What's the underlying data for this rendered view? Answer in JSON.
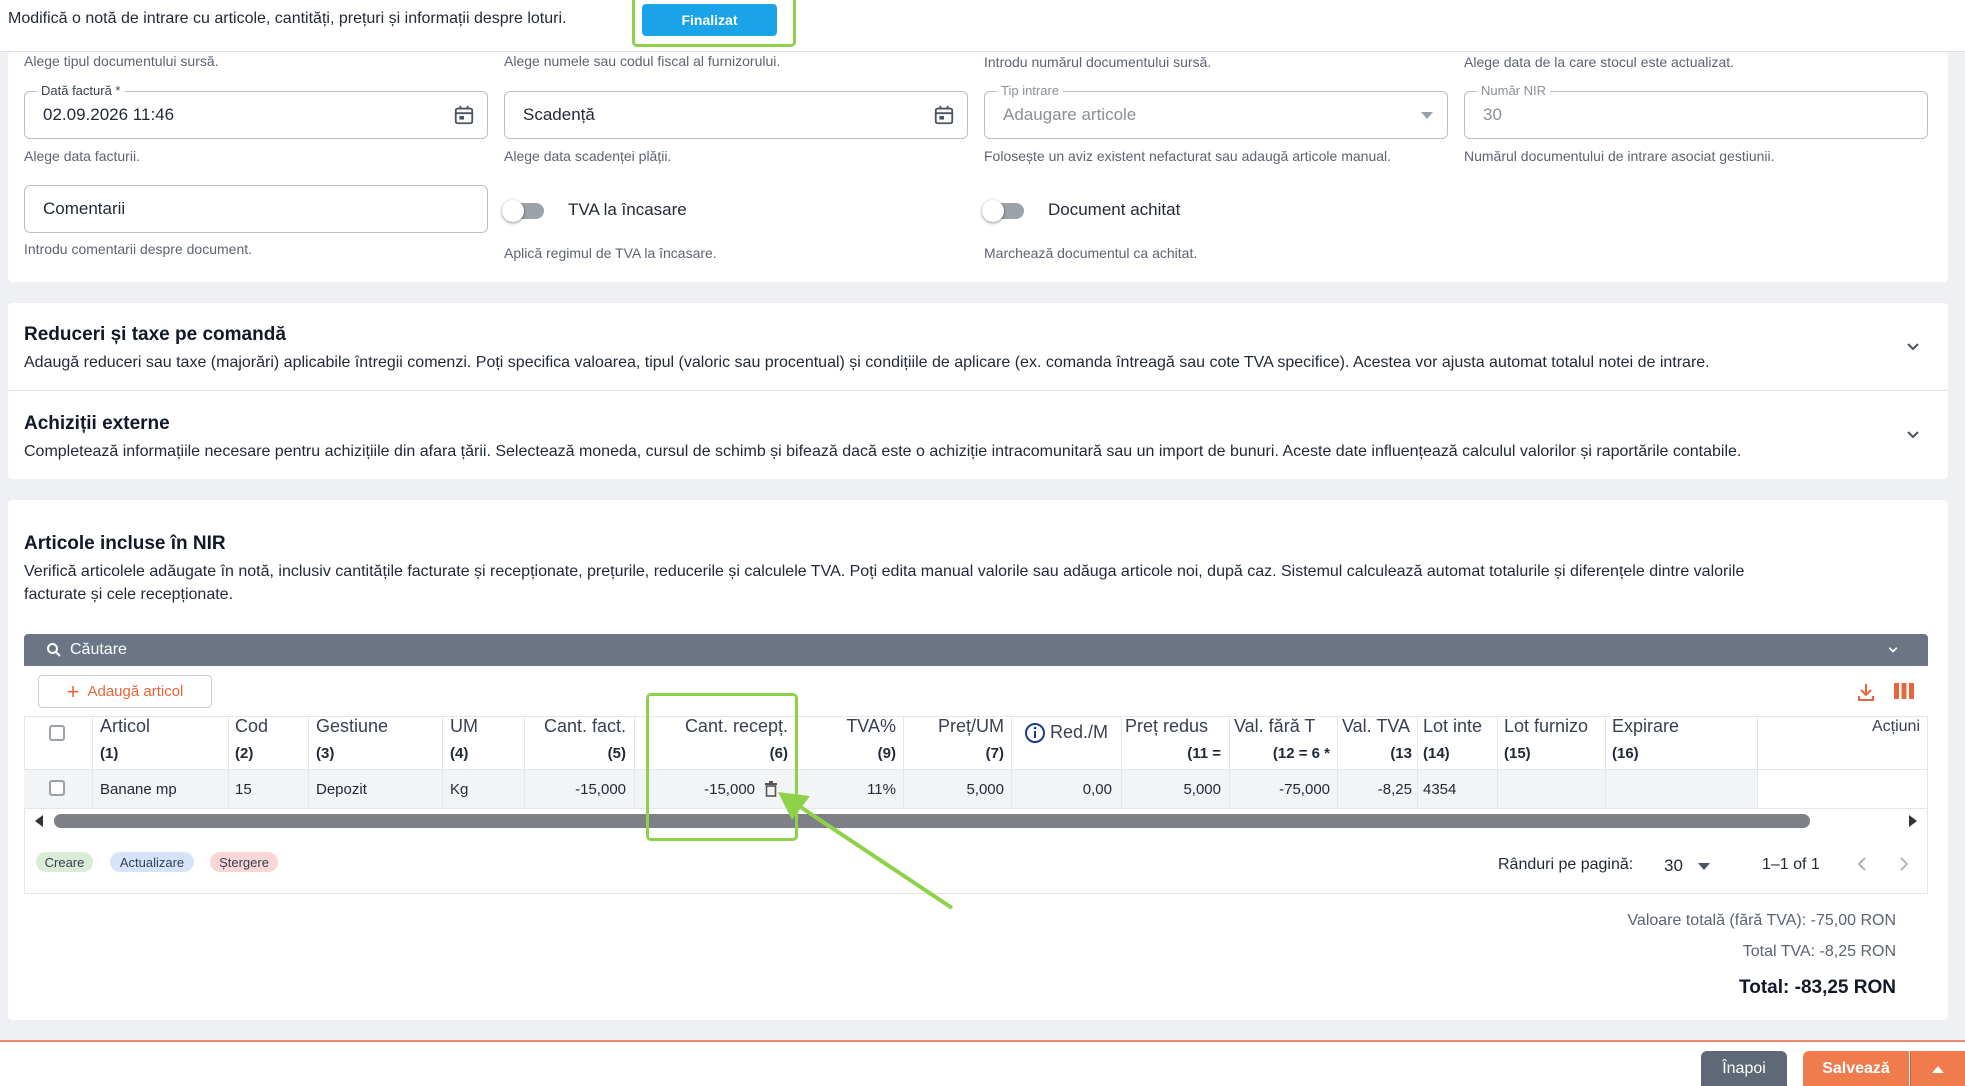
{
  "topbar": {
    "description": "Modifică o notă de intrare cu articole, cantități, prețuri și informații despre loturi.",
    "finalize_label": "Finalizat"
  },
  "form": {
    "hints_top": [
      "Alege tipul documentului sursă.",
      "Alege numele sau codul fiscal al furnizorului.",
      "Introdu numărul documentului sursă.",
      "Alege data de la care stocul este actualizat."
    ],
    "invoice_date": {
      "label": "Dată factură *",
      "value": "02.09.2026 11:46",
      "hint": "Alege data facturii."
    },
    "due_date": {
      "placeholder": "Scadență",
      "hint": "Alege data scadenței plății."
    },
    "entry_type": {
      "label": "Tip intrare",
      "value": "Adaugare articole",
      "hint": "Folosește un aviz existent nefacturat sau adaugă articole manual."
    },
    "nir_number": {
      "label": "Număr NIR",
      "value": "30",
      "hint": "Numărul documentului de intrare asociat gestiunii."
    },
    "comments": {
      "placeholder": "Comentarii",
      "hint": "Introdu comentarii despre document."
    },
    "vat_on_collection": {
      "label": "TVA la încasare",
      "hint": "Aplică regimul de TVA la încasare."
    },
    "document_paid": {
      "label": "Document achitat",
      "hint": "Marchează documentul ca achitat."
    }
  },
  "discounts": {
    "title": "Reduceri și taxe pe comandă",
    "description": "Adaugă reduceri sau taxe (majorări) aplicabile întregii comenzi. Poți specifica valoarea, tipul (valoric sau procentual) și condițiile de aplicare (ex. comanda întreagă sau cote TVA specifice). Acestea vor ajusta automat totalul notei de intrare."
  },
  "external": {
    "title": "Achiziții externe",
    "description": "Completează informațiile necesare pentru achizițiile din afara țării. Selectează moneda, cursul de schimb și bifează dacă este o achiziție intracomunitară sau un import de bunuri. Aceste date influențează calculul valorilor și raportările contabile."
  },
  "articles": {
    "title": "Articole incluse în NIR",
    "description_1": "Verifică articolele adăugate în notă, inclusiv cantitățile facturate și recepționate, prețurile, reducerile și calculele TVA. Poți edita manual valorile sau adăuga articole noi, după caz. Sistemul calculează automat totalurile și diferențele dintre valorile",
    "description_2": "facturate și cele recepționate.",
    "search_label": "Căutare",
    "add_label": "Adaugă articol",
    "columns": [
      {
        "name": "Articol",
        "num": "(1)"
      },
      {
        "name": "Cod",
        "num": "(2)"
      },
      {
        "name": "Gestiune",
        "num": "(3)"
      },
      {
        "name": "UM",
        "num": "(4)"
      },
      {
        "name": "Cant. fact.",
        "num": "(5)"
      },
      {
        "name": "Cant. recepț.",
        "num": "(6)"
      },
      {
        "name": "TVA%",
        "num": "(9)"
      },
      {
        "name": "Preț/UM",
        "num": "(7)"
      },
      {
        "name": "Red./M",
        "num": ""
      },
      {
        "name": "Preț redus",
        "num": "(11 ="
      },
      {
        "name": "Val. fără T",
        "num": "(12 = 6 *"
      },
      {
        "name": "Val. TVA",
        "num": "(13"
      },
      {
        "name": "Lot inte",
        "num": "(14)"
      },
      {
        "name": "Lot furnizo",
        "num": "(15)"
      },
      {
        "name": "Expirare",
        "num": "(16)"
      },
      {
        "name": "Acțiuni",
        "num": ""
      }
    ],
    "row": {
      "article": "Banane mp",
      "code": "15",
      "warehouse": "Depozit",
      "um": "Kg",
      "qty_invoiced": "-15,000",
      "qty_received": "-15,000",
      "vat": "11%",
      "price": "5,000",
      "discount": "0,00",
      "reduced_price": "5,000",
      "value_no_vat": "-75,000",
      "vat_value": "-8,25",
      "internal_lot": "4354"
    },
    "legend": {
      "create": "Creare",
      "update": "Actualizare",
      "delete": "Ștergere"
    },
    "pagination": {
      "rows_label": "Rânduri pe pagină:",
      "rows_value": "30",
      "range": "1–1 of 1"
    },
    "totals": {
      "net": "Valoare totală (fără TVA): -75,00 RON",
      "vat": "Total TVA: -8,25 RON",
      "grand": "Total: -83,25 RON"
    }
  },
  "footer": {
    "back_label": "Înapoi",
    "save_label": "Salvează"
  },
  "colors": {
    "accent_blue": "#1aa3e8",
    "accent_orange": "#f07c4e",
    "highlight_green": "#8ed24a",
    "search_bar": "#6b7585"
  }
}
